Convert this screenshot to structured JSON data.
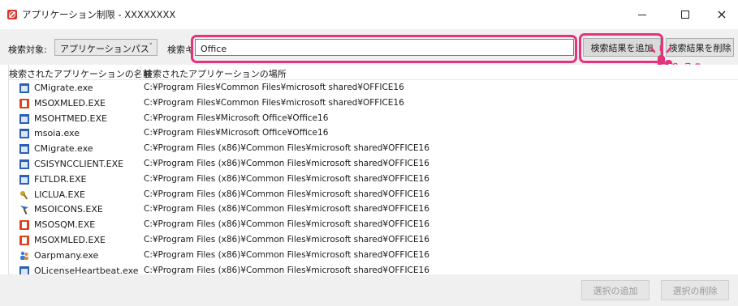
{
  "window": {
    "title": "アプリケーション制限 - XXXXXXXX",
    "minimize": "—",
    "maximize": "□",
    "close": "×"
  },
  "toolbar": {
    "search_target_label": "検索対象:",
    "search_target_value": "アプリケーションパス",
    "search_key_label": "検索キー",
    "search_value": "Office",
    "add_results_label": "検索結果を追加",
    "remove_results_label": "検索結果を削除"
  },
  "callout": {
    "text": "Click!",
    "color": "#e4337a"
  },
  "table": {
    "headers": [
      "検索されたアプリケーションの名前",
      "検索されたアプリケーションの場所"
    ],
    "rows": [
      {
        "icon": "window-icon",
        "name": "CMigrate.exe",
        "path": "C:¥Program Files¥Common Files¥microsoft shared¥OFFICE16"
      },
      {
        "icon": "office-icon",
        "name": "MSOXMLED.EXE",
        "path": "C:¥Program Files¥Common Files¥microsoft shared¥OFFICE16"
      },
      {
        "icon": "window-icon",
        "name": "MSOHTMED.EXE",
        "path": "C:¥Program Files¥Microsoft Office¥Office16"
      },
      {
        "icon": "window-icon",
        "name": "msoia.exe",
        "path": "C:¥Program Files¥Microsoft Office¥Office16"
      },
      {
        "icon": "window-icon",
        "name": "CMigrate.exe",
        "path": "C:¥Program Files (x86)¥Common Files¥microsoft shared¥OFFICE16"
      },
      {
        "icon": "window-icon",
        "name": "CSISYNCCLIENT.EXE",
        "path": "C:¥Program Files (x86)¥Common Files¥microsoft shared¥OFFICE16"
      },
      {
        "icon": "window-icon",
        "name": "FLTLDR.EXE",
        "path": "C:¥Program Files (x86)¥Common Files¥microsoft shared¥OFFICE16"
      },
      {
        "icon": "key-icon",
        "name": "LICLUA.EXE",
        "path": "C:¥Program Files (x86)¥Common Files¥microsoft shared¥OFFICE16"
      },
      {
        "icon": "brush-icon",
        "name": "MSOICONS.EXE",
        "path": "C:¥Program Files (x86)¥Common Files¥microsoft shared¥OFFICE16"
      },
      {
        "icon": "office-icon",
        "name": "MSOSQM.EXE",
        "path": "C:¥Program Files (x86)¥Common Files¥microsoft shared¥OFFICE16"
      },
      {
        "icon": "office-icon",
        "name": "MSOXMLED.EXE",
        "path": "C:¥Program Files (x86)¥Common Files¥microsoft shared¥OFFICE16"
      },
      {
        "icon": "people-icon",
        "name": "Oarpmany.exe",
        "path": "C:¥Program Files (x86)¥Common Files¥microsoft shared¥OFFICE16"
      },
      {
        "icon": "window-icon",
        "name": "OLicenseHeartbeat.exe",
        "path": "C:¥Program Files (x86)¥Common Files¥microsoft shared¥OFFICE16"
      }
    ]
  },
  "bottom": {
    "add_selection_label": "選択の追加",
    "remove_selection_label": "選択の削除"
  }
}
